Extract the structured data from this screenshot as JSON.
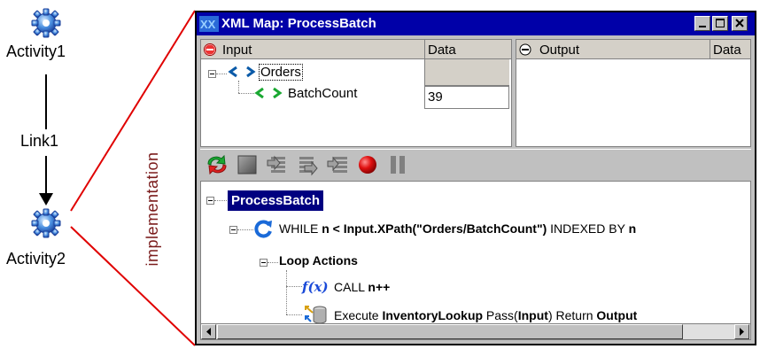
{
  "diagram": {
    "activity1_label": "Activity1",
    "link_label": "Link1",
    "activity2_label": "Activity2",
    "implementation_label": "implementation"
  },
  "window": {
    "title": "XML Map: ProcessBatch",
    "input_pane": {
      "col_name": "Input",
      "col_data": "Data",
      "rows": [
        {
          "name": "Orders",
          "data": ""
        },
        {
          "name": "BatchCount",
          "data": "39"
        }
      ]
    },
    "output_pane": {
      "col_name": "Output",
      "col_data": "Data"
    },
    "code": {
      "root": "ProcessBatch",
      "while_prefix": "WHILE ",
      "while_cond": "n < Input.XPath(\"Orders/BatchCount\")",
      "while_mid": " INDEXED BY ",
      "while_var": "n",
      "loop_actions": "Loop Actions",
      "call_prefix": "CALL ",
      "call_expr": "n++",
      "fx_label": "f(x)",
      "exec_prefix": "Execute ",
      "exec_name": "InventoryLookup",
      "exec_pass": " Pass(",
      "exec_pass_arg": "Input",
      "exec_return": ") Return ",
      "exec_return_arg": "Output"
    }
  }
}
